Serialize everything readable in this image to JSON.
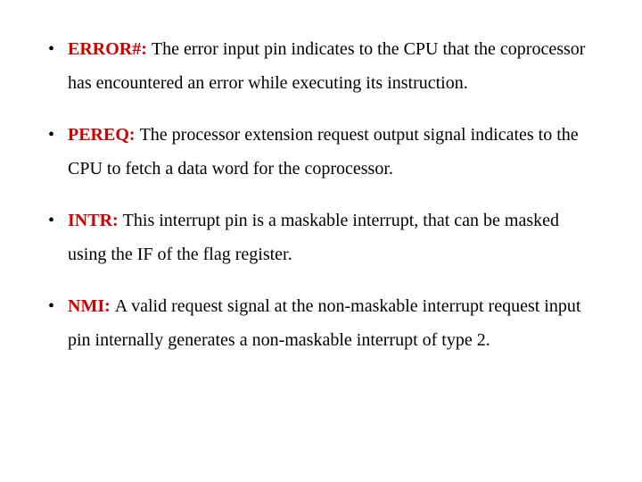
{
  "items": [
    {
      "term": "ERROR#: ",
      "body": "The error input pin indicates to the CPU that the coprocessor has encountered an error while executing its instruction."
    },
    {
      "term": "PEREQ: ",
      "body": "The processor extension request output signal indicates to the CPU to fetch a data word for the coprocessor."
    },
    {
      "term": "INTR: ",
      "body": "This interrupt pin is a maskable interrupt, that can be masked using the IF of the flag register."
    },
    {
      "term": "NMI: ",
      "body": "A valid request signal at the non-maskable interrupt request input pin internally generates a non-maskable interrupt of type 2."
    }
  ]
}
